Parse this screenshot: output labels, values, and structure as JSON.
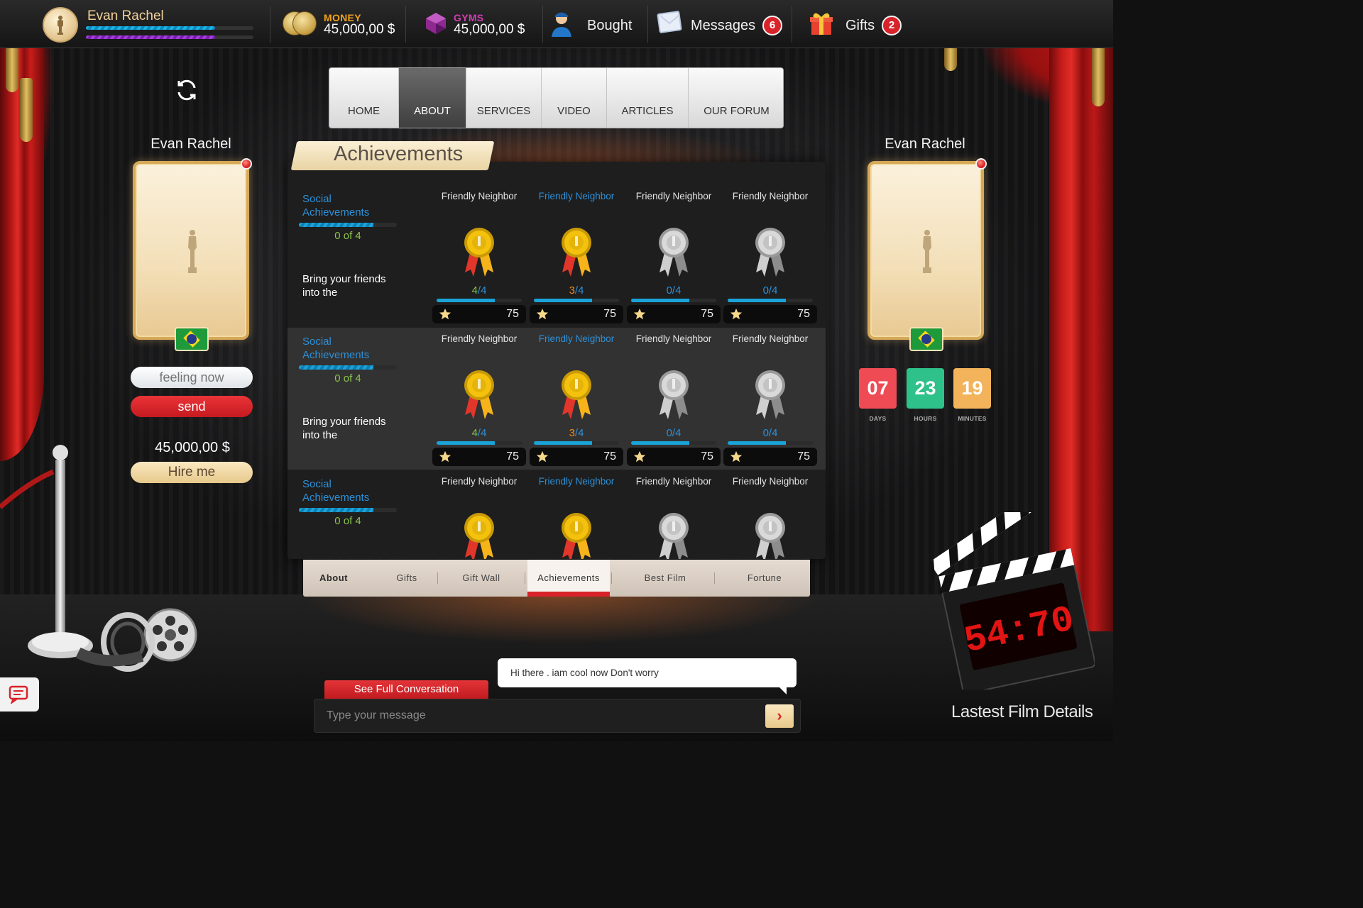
{
  "topbar": {
    "username": "Evan Rachel",
    "xp_level": 0.77,
    "energy_level": 0.77,
    "money_label": "MONEY",
    "money_value": "45,000,00 $",
    "gyms_label": "GYMS",
    "gyms_value": "45,000,00 $",
    "bought_label": "Bought",
    "messages_label": "Messages",
    "messages_count": "6",
    "gifts_label": "Gifts",
    "gifts_count": "2"
  },
  "menu": {
    "items": [
      "HOME",
      "ABOUT",
      "SERVICES",
      "VIDEO",
      "ARTICLES",
      "OUR FORUM"
    ],
    "active": "ABOUT"
  },
  "left_profile": {
    "name": "Evan Rachel",
    "feeling_placeholder": "feeling now",
    "send_label": "send",
    "amount": "45,000,00 $",
    "hire_label": "Hire me"
  },
  "right_profile": {
    "name": "Evan Rachel",
    "countdown": {
      "days": "07",
      "days_label": "DAYS",
      "hours": "23",
      "hours_label": "HOURS",
      "minutes": "19",
      "minutes_label": "MINUTES"
    }
  },
  "achievements": {
    "title": "Achievements",
    "rows": [
      {
        "category": "Social Achievements",
        "count": "0 of 4",
        "description": "Bring your friends into the",
        "items": [
          {
            "name": "Friendly Neighbor",
            "medal": "gold",
            "done": "4",
            "total": "/4",
            "done_color": "#8bc34a",
            "points": "75"
          },
          {
            "name": "Friendly Neighbor",
            "medal": "gold",
            "done": "3",
            "total": "/4",
            "done_color": "#f08a24",
            "points": "75"
          },
          {
            "name": "Friendly Neighbor",
            "medal": "silver",
            "done": "0",
            "total": "/4",
            "done_color": "#2e8fd6",
            "points": "75"
          },
          {
            "name": "Friendly Neighbor",
            "medal": "silver",
            "done": "0",
            "total": "/4",
            "done_color": "#2e8fd6",
            "points": "75"
          }
        ]
      },
      {
        "category": "Social Achievements",
        "count": "0 of 4",
        "description": "Bring your friends into the",
        "items": [
          {
            "name": "Friendly Neighbor",
            "medal": "gold",
            "done": "4",
            "total": "/4",
            "done_color": "#8bc34a",
            "points": "75"
          },
          {
            "name": "Friendly Neighbor",
            "medal": "gold",
            "done": "3",
            "total": "/4",
            "done_color": "#f08a24",
            "points": "75"
          },
          {
            "name": "Friendly Neighbor",
            "medal": "silver",
            "done": "0",
            "total": "/4",
            "done_color": "#2e8fd6",
            "points": "75"
          },
          {
            "name": "Friendly Neighbor",
            "medal": "silver",
            "done": "0",
            "total": "/4",
            "done_color": "#2e8fd6",
            "points": "75"
          }
        ]
      },
      {
        "category": "Social Achievements",
        "count": "0 of 4",
        "description": "",
        "items": [
          {
            "name": "Friendly Neighbor",
            "medal": "gold"
          },
          {
            "name": "Friendly Neighbor",
            "medal": "gold"
          },
          {
            "name": "Friendly Neighbor",
            "medal": "silver"
          },
          {
            "name": "Friendly Neighbor",
            "medal": "silver"
          }
        ]
      }
    ]
  },
  "bottom_tabs": {
    "items": [
      "About",
      "Gifts",
      "Gift Wall",
      "Achievements",
      "Best Film",
      "Fortune"
    ],
    "active": "Achievements"
  },
  "chat": {
    "see_full_label": "See Full Conversation",
    "last_message": "Hi there . iam cool now Don't worry",
    "input_placeholder": "Type your message"
  },
  "clapper_display": "54:70",
  "film_details_label": "Lastest Film Details"
}
